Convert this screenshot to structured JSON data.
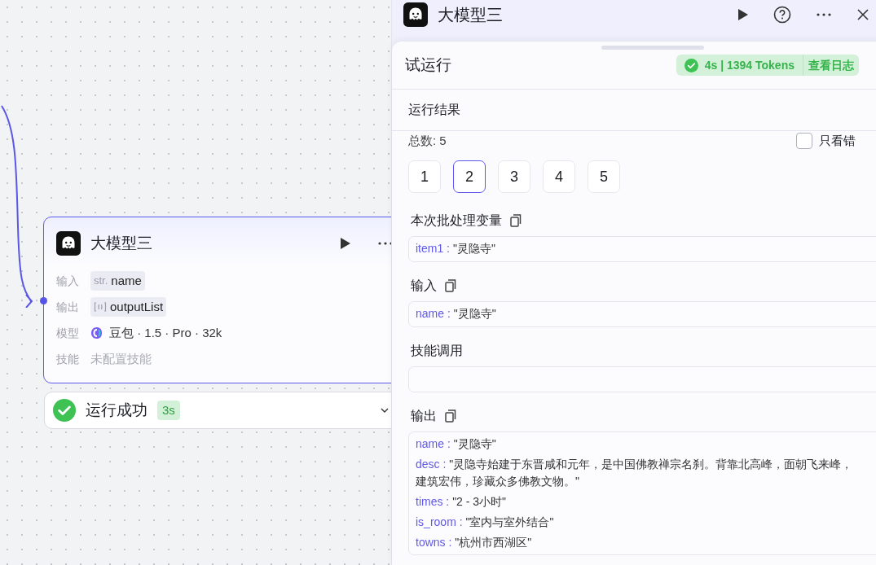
{
  "canvas": {
    "node": {
      "title": "大模型三",
      "fields": [
        {
          "label": "输入",
          "kind": "str",
          "type": "str.",
          "value": "name"
        },
        {
          "label": "输出",
          "kind": "list",
          "value": "outputList"
        },
        {
          "label": "模型",
          "kind": "model",
          "value": "豆包 · 1.5 · Pro · 32k"
        },
        {
          "label": "技能",
          "kind": "empty",
          "value": "未配置技能"
        }
      ]
    },
    "status": {
      "label": "运行成功",
      "time": "3s"
    }
  },
  "panel": {
    "title": "大模型三",
    "test_run": {
      "title": "试运行",
      "summary": "4s | 1394 Tokens",
      "log_link": "查看日志"
    },
    "result_title": "运行结果",
    "total": "总数: 5",
    "only_errors": {
      "label": "只看错",
      "checked": false
    },
    "pages": [
      {
        "label": "1",
        "selected": false
      },
      {
        "label": "2",
        "selected": true
      },
      {
        "label": "3",
        "selected": false
      },
      {
        "label": "4",
        "selected": false
      },
      {
        "label": "5",
        "selected": false
      }
    ],
    "sections": [
      {
        "title": "本次批处理变量",
        "copyable": true,
        "lines": [
          {
            "key": "item1 :",
            "value": "\"灵隐寺\""
          }
        ]
      },
      {
        "title": "输入",
        "copyable": true,
        "lines": [
          {
            "key": "name :",
            "value": "\"灵隐寺\""
          }
        ]
      },
      {
        "title": "技能调用",
        "copyable": false
      },
      {
        "title": "输出",
        "copyable": true,
        "lines": [
          {
            "key": "name :",
            "value": "\"灵隐寺\""
          },
          {
            "key": "desc :",
            "value": "\"灵隐寺始建于东晋咸和元年，是中国佛教禅宗名刹。背靠北高峰，面朝飞来峰，建筑宏伟，珍藏众多佛教文物。\""
          },
          {
            "key": "times :",
            "value": "\"2 - 3小时\""
          },
          {
            "key": "is_room :",
            "value": "\"室内与室外结合\""
          },
          {
            "key": "towns :",
            "value": "\"杭州市西湖区\""
          }
        ]
      }
    ]
  }
}
